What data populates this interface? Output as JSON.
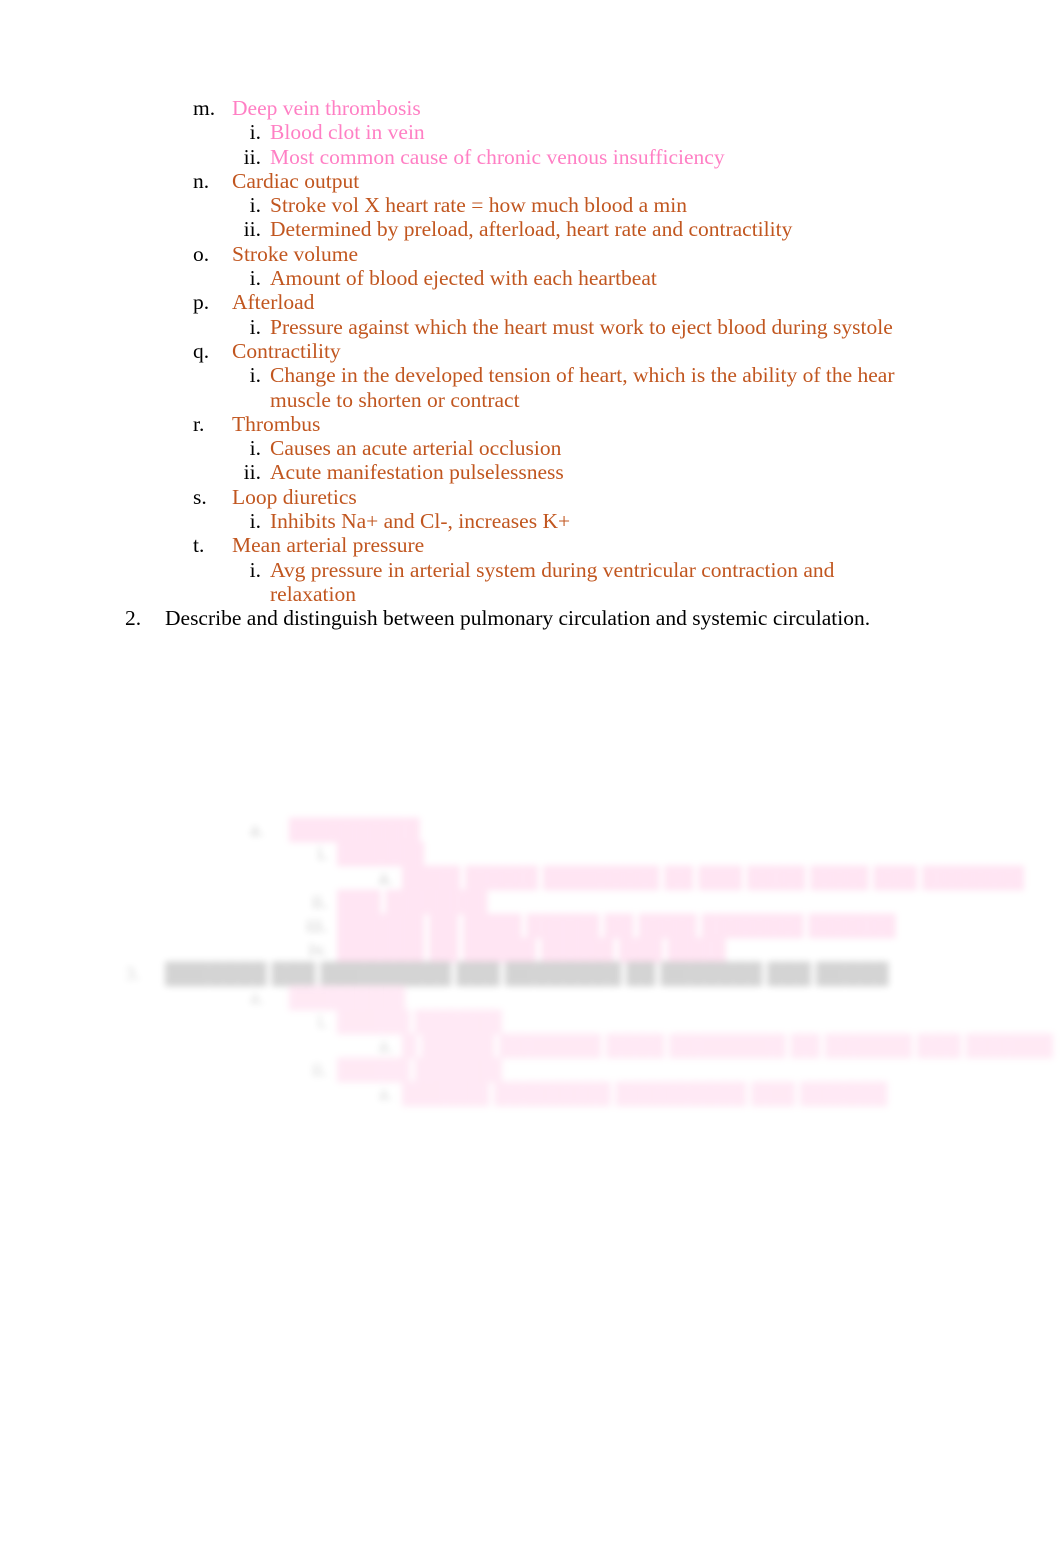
{
  "document": {
    "colors": {
      "pink": "#ff7fc4",
      "orange": "#c1561f",
      "black": "#000000",
      "background": "#ffffff"
    }
  },
  "outline": [
    {
      "marker": "m.",
      "level": "letter",
      "color": "pink",
      "text": "Deep vein thrombosis"
    },
    {
      "marker": "i.",
      "level": "roman",
      "color": "pink",
      "text": "Blood clot in vein"
    },
    {
      "marker": "ii.",
      "level": "roman",
      "color": "pink",
      "text": "Most common cause of chronic venous insufficiency"
    },
    {
      "marker": "n.",
      "level": "letter",
      "color": "orange",
      "text": "Cardiac output"
    },
    {
      "marker": "i.",
      "level": "roman",
      "color": "orange",
      "text": "Stroke vol X heart rate = how much blood a min"
    },
    {
      "marker": "ii.",
      "level": "roman",
      "color": "orange",
      "text": "Determined by preload, afterload, heart rate and contractility"
    },
    {
      "marker": "o.",
      "level": "letter",
      "color": "orange",
      "text": "Stroke volume"
    },
    {
      "marker": "i.",
      "level": "roman",
      "color": "orange",
      "text": "Amount of blood ejected with each heartbeat"
    },
    {
      "marker": "p.",
      "level": "letter",
      "color": "orange",
      "text": "Afterload"
    },
    {
      "marker": "i.",
      "level": "roman",
      "color": "orange",
      "text": "Pressure against which the heart must work to eject blood during systole"
    },
    {
      "marker": "q.",
      "level": "letter",
      "color": "orange",
      "text": "Contractility"
    },
    {
      "marker": "i.",
      "level": "roman",
      "color": "orange",
      "text": "Change in the developed tension of heart, which is the ability of the hear muscle to shorten or contract"
    },
    {
      "marker": "r.",
      "level": "letter",
      "color": "orange",
      "text": "Thrombus"
    },
    {
      "marker": "i.",
      "level": "roman",
      "color": "orange",
      "text": "Causes an acute arterial occlusion"
    },
    {
      "marker": "ii.",
      "level": "roman",
      "color": "orange",
      "text": "Acute manifestation pulselessness"
    },
    {
      "marker": "s.",
      "level": "letter",
      "color": "orange",
      "text": "Loop diuretics"
    },
    {
      "marker": "i.",
      "level": "roman",
      "color": "orange",
      "text": "Inhibits Na+ and Cl-, increases K+"
    },
    {
      "marker": "t.",
      "level": "letter",
      "color": "orange",
      "text": "Mean arterial pressure"
    },
    {
      "marker": "i.",
      "level": "roman",
      "color": "orange",
      "text": "Avg pressure in arterial system during ventricular contraction and relaxation"
    },
    {
      "marker": "2.",
      "level": "number",
      "color": "black",
      "text": "Describe and distinguish between pulmonary circulation and systemic circulation."
    }
  ],
  "faded_block_upper": [
    {
      "marker": "a.",
      "level": "letter",
      "color": "pink",
      "text": "█████████"
    },
    {
      "marker": "i.",
      "level": "roman",
      "color": "pink",
      "text": "██████"
    },
    {
      "marker": "a.",
      "level": "roman2",
      "color": "pink",
      "text": "████ █████ ████████ ██ ███ ████ ████ ███ ███████"
    },
    {
      "marker": "ii.",
      "level": "roman",
      "color": "pink",
      "text": "███ ███████"
    },
    {
      "marker": "iii.",
      "level": "roman",
      "color": "pink",
      "text": "██████ ██ ████ █████ ██ ████ ███████ ██████"
    },
    {
      "marker": "iv.",
      "level": "roman",
      "color": "pink",
      "text": "██████ ██ █████ █████ ███ ████"
    }
  ],
  "faded_block_lower": [
    {
      "marker": "3.",
      "level": "number",
      "color": "black",
      "text": "███████ ███ █████████ ███ ████████ ██ ███████ ███ █████"
    },
    {
      "marker": "a.",
      "level": "letter",
      "color": "pink",
      "text": "████████"
    },
    {
      "marker": "i.",
      "level": "roman",
      "color": "pink",
      "text": "█████ ██████"
    },
    {
      "marker": "a.",
      "level": "roman2",
      "color": "pink",
      "text": "█ █████ ███████ ████ ████████ ██ ██████ ███ ██████"
    },
    {
      "marker": "ii.",
      "level": "roman",
      "color": "pink",
      "text": "█████ ██████"
    },
    {
      "marker": "a.",
      "level": "roman2",
      "color": "pink",
      "text": "██████ ████████ █████████ ███ ██████"
    }
  ]
}
